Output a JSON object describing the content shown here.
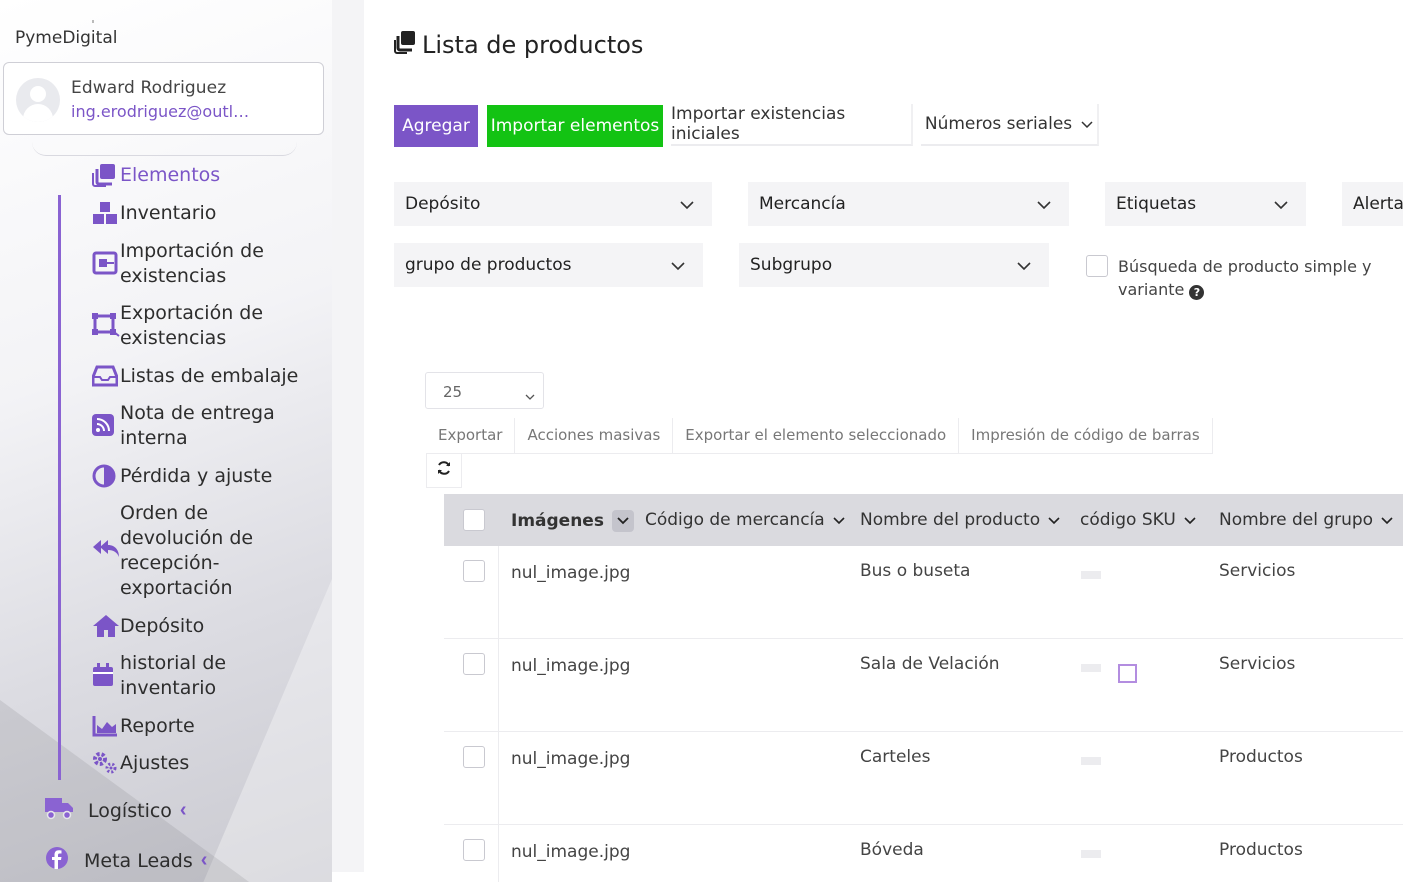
{
  "sidebar": {
    "brand": "PymeDigital",
    "user": {
      "name": "Edward Rodriguez",
      "email": "ing.erodriguez@outlo..."
    },
    "items": [
      {
        "label": "Elementos",
        "icon": "stack-icon",
        "active": true
      },
      {
        "label": "Inventario",
        "icon": "boxes-icon"
      },
      {
        "label": "Importación de existencias",
        "icon": "import-stock-icon"
      },
      {
        "label": "Exportación de existencias",
        "icon": "export-stock-icon"
      },
      {
        "label": "Listas de embalaje",
        "icon": "inbox-icon"
      },
      {
        "label": "Nota de entrega interna",
        "icon": "rss-icon"
      },
      {
        "label": "Pérdida y ajuste",
        "icon": "half-circle-icon"
      },
      {
        "label": "Orden de devolución de recepción-exportación",
        "icon": "reply-all-icon"
      },
      {
        "label": "Depósito",
        "icon": "home-icon"
      },
      {
        "label": "historial de inventario",
        "icon": "calendar-icon"
      },
      {
        "label": "Reporte",
        "icon": "area-chart-icon"
      },
      {
        "label": "Ajustes",
        "icon": "cogs-icon"
      }
    ],
    "sections": [
      {
        "label": "Logístico",
        "icon": "truck-icon"
      },
      {
        "label": "Meta Leads",
        "icon": "facebook-icon"
      }
    ]
  },
  "page": {
    "title": "Lista de productos",
    "buttons": {
      "add": "Agregar",
      "import": "Importar elementos",
      "initial_stock": "Importar existencias iniciales",
      "serial_numbers": "Números seriales"
    },
    "filters": {
      "warehouse": "Depósito",
      "merchandise": "Mercancía",
      "tags": "Etiquetas",
      "alert": "Alerta",
      "product_group": "grupo de productos",
      "subgroup": "Subgrupo",
      "simple_search": "Búsqueda de producto simple y variante"
    },
    "page_size": "25",
    "table_actions": [
      "Exportar",
      "Acciones masivas",
      "Exportar el elemento seleccionado",
      "Impresión de código de barras"
    ],
    "columns": [
      "Imágenes",
      "Código de mercancía",
      "Nombre del producto",
      "código SKU",
      "Nombre del grupo"
    ],
    "rows": [
      {
        "image": "nul_image.jpg",
        "code": "",
        "name": "Bus o buseta",
        "sku": "",
        "group": "Servicios"
      },
      {
        "image": "nul_image.jpg",
        "code": "",
        "name": "Sala de Velación",
        "sku": "",
        "group": "Servicios"
      },
      {
        "image": "nul_image.jpg",
        "code": "",
        "name": "Carteles",
        "sku": "",
        "group": "Productos"
      },
      {
        "image": "nul_image.jpg",
        "code": "",
        "name": "Bóveda",
        "sku": "",
        "group": "Productos"
      }
    ]
  },
  "colors": {
    "accent": "#7b55c7",
    "import_green": "#13c313",
    "header_gray": "#dadadf"
  }
}
